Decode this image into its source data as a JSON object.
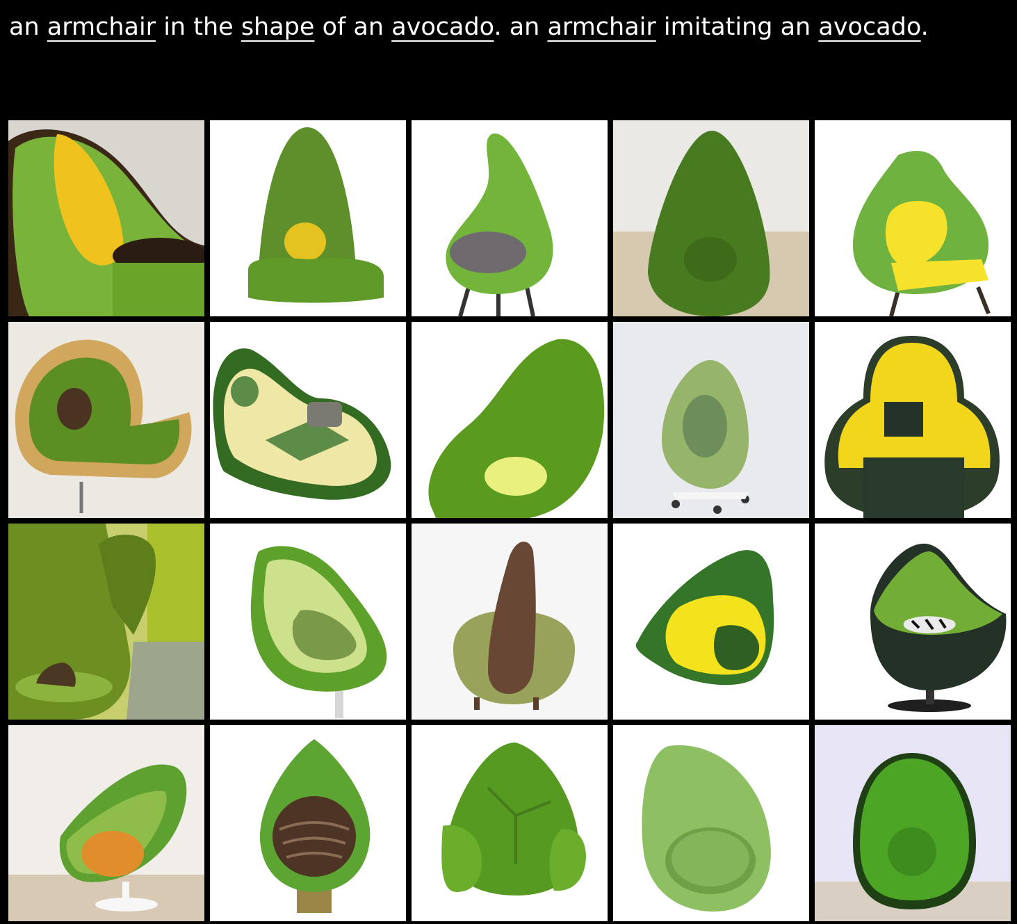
{
  "prompt": {
    "segments": [
      {
        "text": "an ",
        "link": false
      },
      {
        "text": "armchair",
        "link": true
      },
      {
        "text": " in the ",
        "link": false
      },
      {
        "text": "shape",
        "link": true
      },
      {
        "text": " of an ",
        "link": false
      },
      {
        "text": "avocado",
        "link": true
      },
      {
        "text": ". an ",
        "link": false
      },
      {
        "text": "armchair",
        "link": true
      },
      {
        "text": " imitating an ",
        "link": false
      },
      {
        "text": "avocado",
        "link": true
      },
      {
        "text": ".",
        "link": false
      }
    ]
  },
  "colors": {
    "page_background": "#000000",
    "prompt_text": "#ffffff",
    "avocado_green": "#6aa52a",
    "avocado_dark": "#3f6f1b",
    "pit_yellow": "#f0cf1e",
    "pit_brown": "#5a3a24"
  },
  "grid": {
    "rows": 4,
    "columns": 5,
    "images": [
      {
        "name": "image-armchair-green-yellow-pit-ottoman"
      },
      {
        "name": "image-armchair-green-yellow-ball"
      },
      {
        "name": "image-armchair-avocado-egg-legs"
      },
      {
        "name": "image-armchair-dark-green-cone"
      },
      {
        "name": "image-armchair-avocado-yellow-seat"
      },
      {
        "name": "image-armchair-layered-lounge"
      },
      {
        "name": "image-armchair-cream-chaise"
      },
      {
        "name": "image-armchair-green-wave-cushion"
      },
      {
        "name": "image-armchair-sage-egg-wheels"
      },
      {
        "name": "image-armchair-yellow-pear-black-cushion"
      },
      {
        "name": "image-armchair-green-room-interior"
      },
      {
        "name": "image-armchair-half-avocado-swivel"
      },
      {
        "name": "image-armchair-brown-pit-bowl"
      },
      {
        "name": "image-armchair-avocado-yellow-lounger"
      },
      {
        "name": "image-armchair-dark-bowl-pedestal"
      },
      {
        "name": "image-armchair-green-shell-orange-cushion"
      },
      {
        "name": "image-armchair-green-drop-brown-seat"
      },
      {
        "name": "image-armchair-green-leaf-sofa"
      },
      {
        "name": "image-armchair-light-green-pod"
      },
      {
        "name": "image-armchair-green-egg-lavender-wall"
      }
    ]
  }
}
